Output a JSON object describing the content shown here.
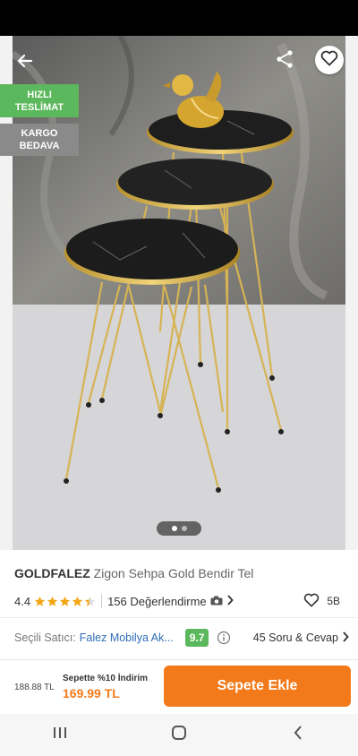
{
  "product": {
    "brand": "GOLDFALEZ",
    "name": "Zigon Sehpa Gold Bendir Tel",
    "rating": "4.4",
    "rating_fraction": 0.88,
    "review_count": "156 Değerlendirme",
    "favorites": "5B"
  },
  "badges": {
    "fast_delivery": [
      "HIZLI",
      "TESLİMAT"
    ],
    "free_cargo": [
      "KARGO",
      "BEDAVA"
    ]
  },
  "gallery": {
    "images": 2,
    "active_index": 0
  },
  "seller": {
    "label": "Seçili Satıcı:",
    "name": "Falez Mobilya Ak...",
    "score": "9.7",
    "qa_label": "45 Soru & Cevap"
  },
  "pricing": {
    "old_price": "188.88 TL",
    "promo": "Sepette %10 İndirim",
    "new_price": "169.99 TL"
  },
  "actions": {
    "add_to_cart": "Sepete Ekle"
  },
  "colors": {
    "accent": "#f27a1a",
    "success": "#5cb85c",
    "link": "#2f6db5",
    "star": "#f2a515"
  },
  "icons": [
    "back-arrow-icon",
    "share-icon",
    "heart-icon",
    "star-icon",
    "camera-icon",
    "chevron-right-icon",
    "info-icon",
    "recent-apps-icon",
    "home-icon",
    "back-nav-icon"
  ]
}
